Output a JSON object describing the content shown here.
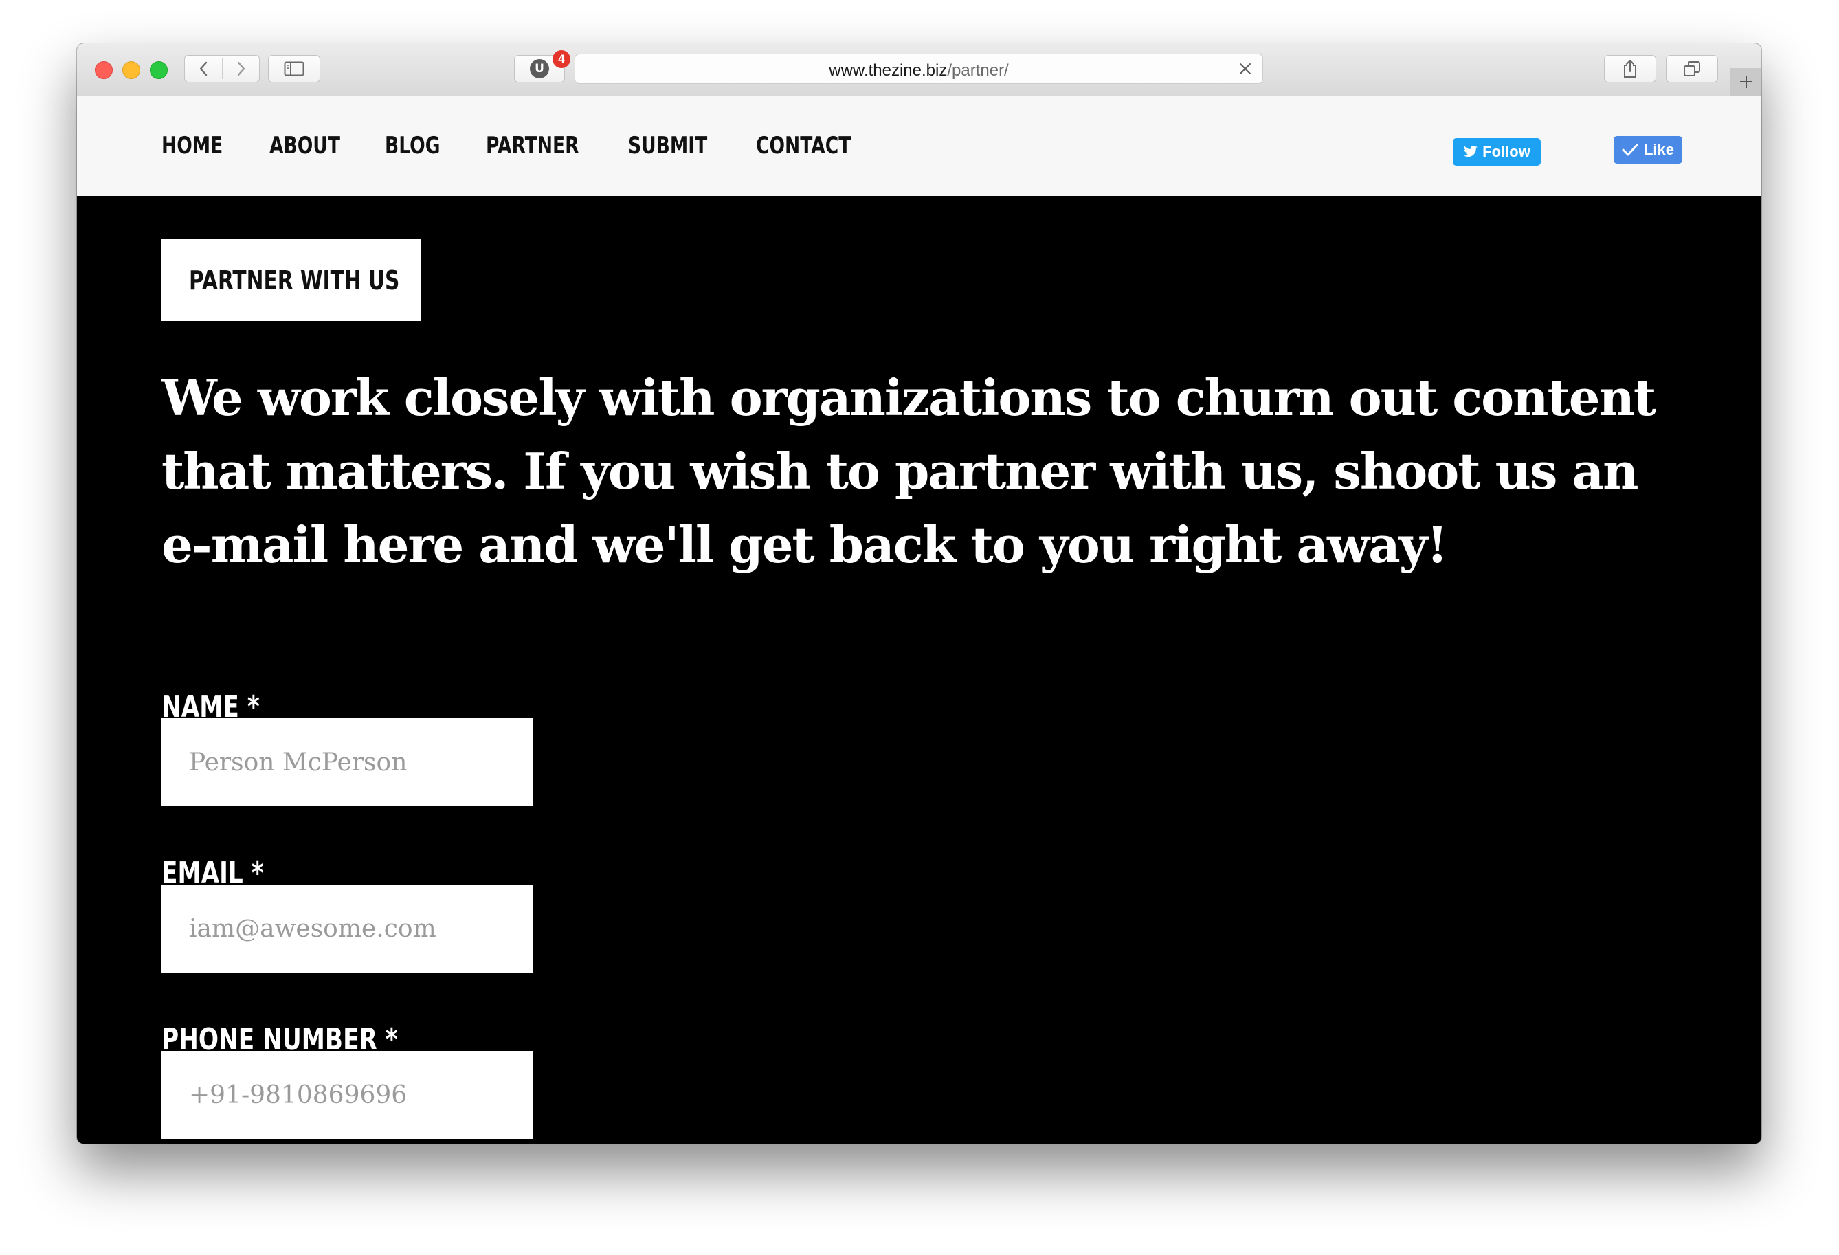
{
  "browser": {
    "url_host": "www.thezine.biz",
    "url_path": "/partner/",
    "extension_badge_count": "4",
    "extension_letter": "U"
  },
  "nav": {
    "items": [
      "HOME",
      "ABOUT",
      "BLOG",
      "PARTNER",
      "SUBMIT",
      "CONTACT"
    ],
    "twitter_follow": "Follow",
    "facebook_like": "Like"
  },
  "page": {
    "badge": "PARTNER WITH US",
    "headline": "We work closely with organizations to churn out content that matters. If you wish to partner with us, shoot us an e-mail here and we'll get back to you right away!"
  },
  "form": {
    "name_label": "NAME *",
    "name_placeholder": "Person McPerson",
    "email_label": "EMAIL *",
    "email_placeholder": "iam@awesome.com",
    "phone_label": "PHONE NUMBER *",
    "phone_placeholder": "+91-9810869696"
  },
  "colors": {
    "twitter": "#1da1f2",
    "facebook": "#4a8ae6",
    "background": "#000000",
    "nav_background": "#f7f7f7"
  }
}
